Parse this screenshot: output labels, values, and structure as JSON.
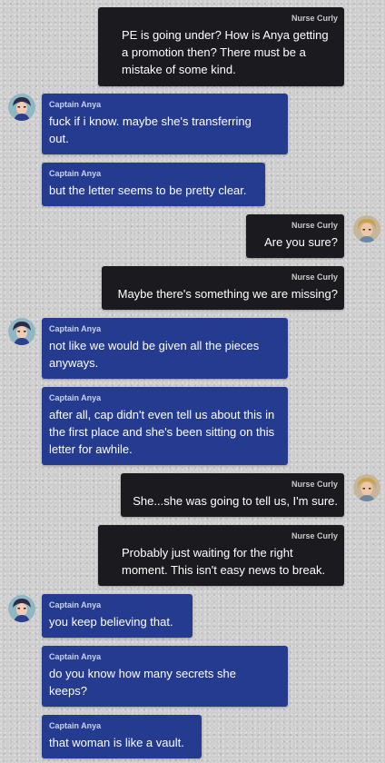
{
  "messages": [
    {
      "sender": "Nurse Curly",
      "text": "PE is going under? How is Anya getting a promotion then? There must be a mistake of some kind."
    },
    {
      "sender": "Captain Anya",
      "text": "fuck if i know. maybe she's transferring out."
    },
    {
      "sender": "Captain Anya",
      "text": "but the letter seems to be pretty clear."
    },
    {
      "sender": "Nurse Curly",
      "text": "Are you sure?"
    },
    {
      "sender": "Nurse Curly",
      "text": "Maybe there's something we are missing?"
    },
    {
      "sender": "Captain Anya",
      "text": "not like we would be given all the pieces anyways."
    },
    {
      "sender": "Captain Anya",
      "text": "after all, cap didn't even tell us about this in the first place and she's been sitting on this letter for awhile."
    },
    {
      "sender": "Nurse Curly",
      "text": "She...she was going to tell us, I'm sure."
    },
    {
      "sender": "Nurse Curly",
      "text": "Probably just waiting for the right moment. This isn't easy news to break."
    },
    {
      "sender": "Captain Anya",
      "text": "you keep believing that."
    },
    {
      "sender": "Captain Anya",
      "text": "do you know how many secrets she keeps?"
    },
    {
      "sender": "Captain Anya",
      "text": "that woman is like a vault."
    }
  ],
  "colors": {
    "curly_bubble": "#1b1b1f",
    "anya_bubble": "#243b8f",
    "background": "#cdcdcd"
  },
  "icons": {
    "anya_avatar": "captain-anya-avatar",
    "curly_avatar": "nurse-curly-avatar"
  }
}
